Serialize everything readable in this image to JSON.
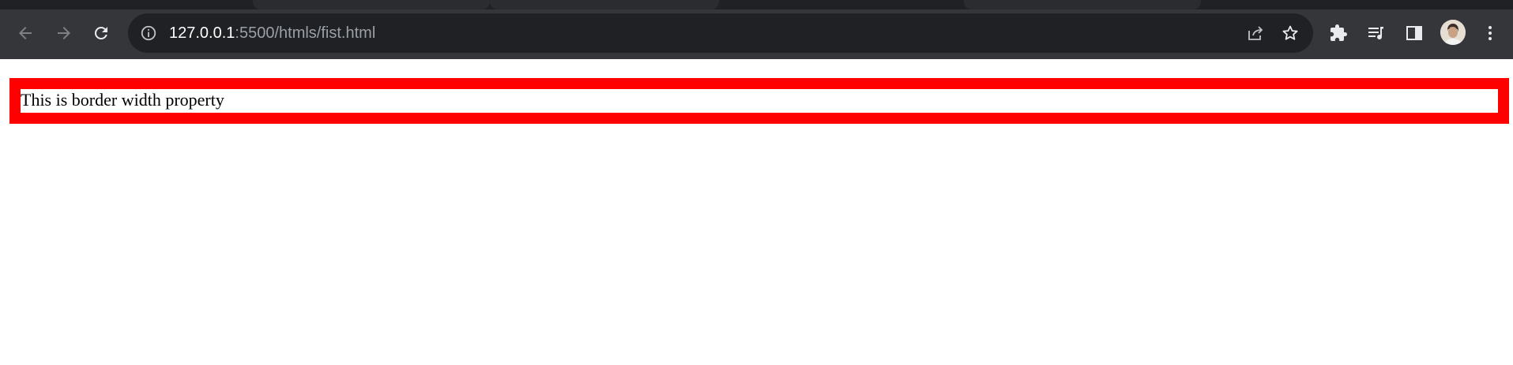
{
  "browser": {
    "url_host": "127.0.0.1",
    "url_rest": ":5500/htmls/fist.html",
    "icons": {
      "back": "arrow-left-icon",
      "forward": "arrow-right-icon",
      "reload": "reload-icon",
      "site_info": "info-icon",
      "share": "share-icon",
      "bookmark": "star-icon",
      "extensions": "puzzle-icon",
      "media": "media-queue-icon",
      "side_panel": "side-panel-icon",
      "menu": "kebab-menu-icon"
    },
    "colors": {
      "frame": "#35363a",
      "omnibox": "#202124",
      "url_host": "#ffffff",
      "url_rest": "#9aa0a6"
    }
  },
  "page": {
    "text": "This is border width property",
    "colors": {
      "border": "#ff0000",
      "background": "#ffffff",
      "text": "#000000"
    }
  }
}
